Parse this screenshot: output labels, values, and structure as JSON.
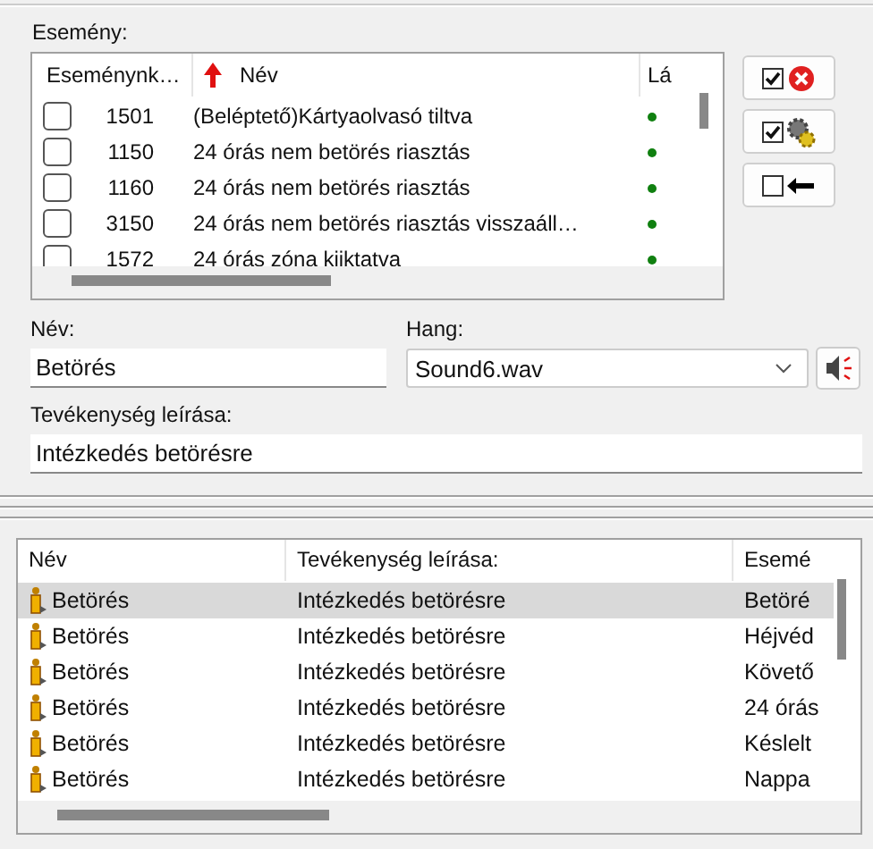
{
  "event_section": {
    "label": "Esemény:",
    "columns": [
      "Eseménynk…",
      "Név",
      "Lá"
    ],
    "rows": [
      {
        "checked": false,
        "code": "1501",
        "name": "(Beléptető)Kártyaolvasó  tiltva",
        "color": "#108010"
      },
      {
        "checked": false,
        "code": "1150",
        "name": "24 órás nem betörés riasztás",
        "color": "#108010"
      },
      {
        "checked": false,
        "code": "1160",
        "name": "24 órás nem betörés riasztás",
        "color": "#108010"
      },
      {
        "checked": false,
        "code": "3150",
        "name": "24 órás nem betörés riasztás visszaáll…",
        "color": "#108010"
      },
      {
        "checked": false,
        "code": "1572",
        "name": "24 órás zóna kiiktatva",
        "color": "#108010"
      }
    ]
  },
  "name_field": {
    "label": "Név:",
    "value": "Betörés"
  },
  "sound_field": {
    "label": "Hang:",
    "value": "Sound6.wav"
  },
  "action_field": {
    "label": "Tevékenység leírása:",
    "value": "Intézkedés betörésre"
  },
  "table": {
    "columns": [
      "Név",
      "Tevékenység leírása:",
      "Esemé"
    ],
    "rows": [
      {
        "selected": true,
        "name": "Betörés",
        "action": "Intézkedés betörésre",
        "event": "Betöré"
      },
      {
        "selected": false,
        "name": "Betörés",
        "action": "Intézkedés betörésre",
        "event": "Héjvéd"
      },
      {
        "selected": false,
        "name": "Betörés",
        "action": "Intézkedés betörésre",
        "event": "Követő"
      },
      {
        "selected": false,
        "name": "Betörés",
        "action": "Intézkedés betörésre",
        "event": "24 órás"
      },
      {
        "selected": false,
        "name": "Betörés",
        "action": "Intézkedés betörésre",
        "event": "Késlelt"
      },
      {
        "selected": false,
        "name": "Betörés",
        "action": "Intézkedés betörésre",
        "event": "Nappa"
      }
    ]
  }
}
